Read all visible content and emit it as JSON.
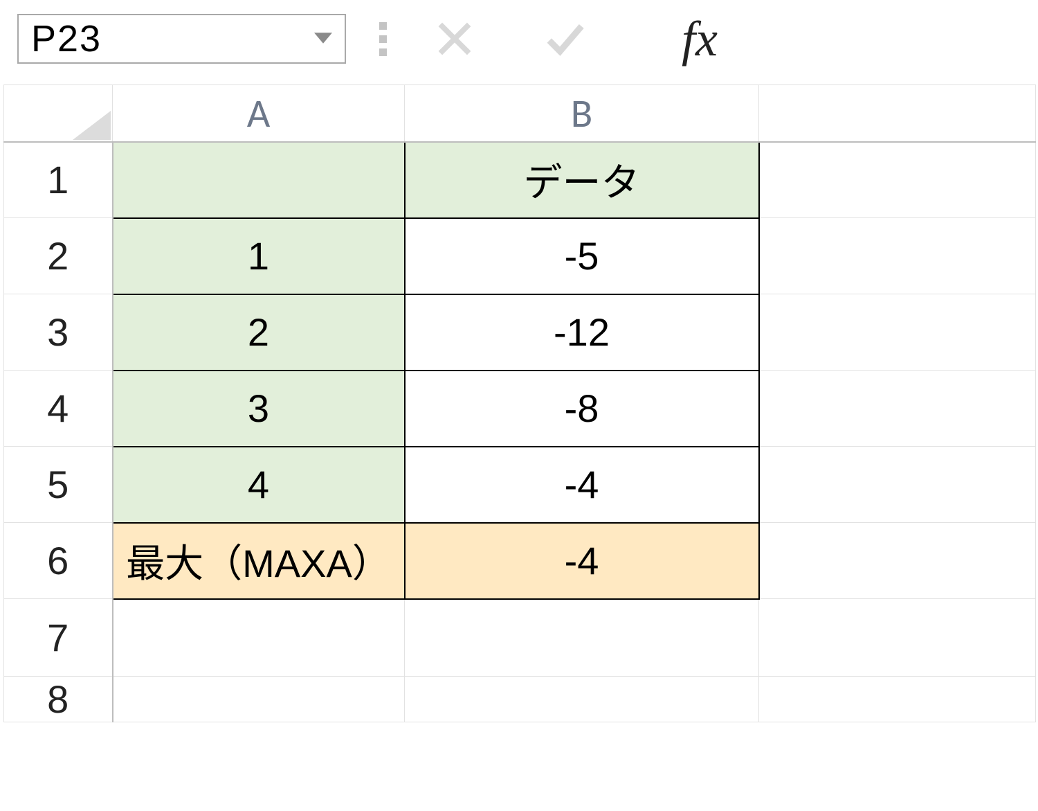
{
  "name_box": {
    "value": "P23"
  },
  "columns": {
    "A": "A",
    "B": "B"
  },
  "rows": [
    "1",
    "2",
    "3",
    "4",
    "5",
    "6",
    "7",
    "8"
  ],
  "cells": {
    "A1": "",
    "B1": "データ",
    "A2": "1",
    "B2": "-5",
    "A3": "2",
    "B3": "-12",
    "A4": "3",
    "B4": "-8",
    "A5": "4",
    "B5": "-4",
    "A6": "最大（MAXA）",
    "B6": "-4"
  },
  "icons": {
    "fx": "fx"
  },
  "chart_data": {
    "type": "table",
    "title": "データ",
    "series": [
      {
        "name": "データ",
        "values": [
          -5,
          -12,
          -8,
          -4
        ]
      }
    ],
    "categories": [
      "1",
      "2",
      "3",
      "4"
    ],
    "summary": {
      "label": "最大（MAXA）",
      "value": -4
    }
  }
}
